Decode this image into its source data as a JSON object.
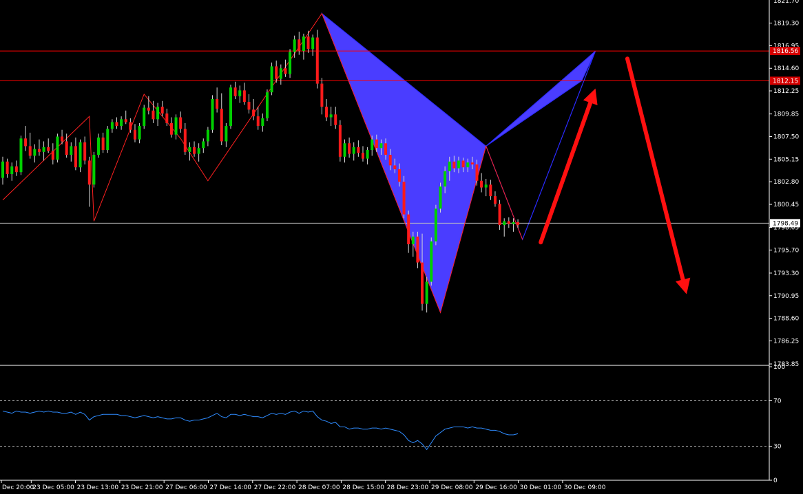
{
  "chart_data": {
    "type": "candlestick",
    "instrument_note": "",
    "colors": {
      "background": "#000000",
      "bull": "#00d000",
      "bear": "#ff1a1a",
      "zigzag": "#ff2020",
      "pattern_fill": "#4a3dff",
      "pattern_line": "#2a2aff",
      "arrow": "#ff1010",
      "level_line": "#ff0000",
      "rsi_line": "#2f8cff",
      "axis": "#ffffff",
      "current_price_line": "#c0c0c0"
    },
    "price_axis": {
      "ylim": [
        1783.85,
        1821.7
      ],
      "ticks": [
        "1819.30",
        "1816.95",
        "1814.60",
        "1812.25",
        "1809.85",
        "1807.50",
        "1805.15",
        "1802.80",
        "1800.45",
        "1798.05",
        "1795.70",
        "1793.30",
        "1790.95",
        "1788.60",
        "1786.25",
        "1783.85"
      ],
      "top_partial_tick": "1821.70"
    },
    "current_price": {
      "value": 1798.49,
      "label": "1798.49"
    },
    "levels": [
      {
        "value": 1816.4,
        "label": "1816.56"
      },
      {
        "value": 1813.3,
        "label": "1812.15"
      }
    ],
    "time_axis": {
      "labels": [
        "Dec 20:00",
        "23 Dec 05:00",
        "23 Dec 13:00",
        "23 Dec 21:00",
        "27 Dec 06:00",
        "27 Dec 14:00",
        "27 Dec 22:00",
        "28 Dec 07:00",
        "28 Dec 15:00",
        "28 Dec 23:00",
        "29 Dec 08:00",
        "29 Dec 16:00",
        "30 Dec 01:00",
        "30 Dec 09:00"
      ]
    },
    "candles": [
      {
        "o": 1803.2,
        "h": 1805.4,
        "l": 1802.5,
        "c": 1804.9
      },
      {
        "o": 1804.9,
        "h": 1805.2,
        "l": 1803.2,
        "c": 1803.6
      },
      {
        "o": 1803.6,
        "h": 1804.8,
        "l": 1802.9,
        "c": 1804.4
      },
      {
        "o": 1804.4,
        "h": 1805.0,
        "l": 1803.4,
        "c": 1803.8
      },
      {
        "o": 1803.8,
        "h": 1807.6,
        "l": 1803.5,
        "c": 1807.3
      },
      {
        "o": 1807.3,
        "h": 1808.6,
        "l": 1806.0,
        "c": 1806.5
      },
      {
        "o": 1806.5,
        "h": 1807.9,
        "l": 1805.2,
        "c": 1805.5
      },
      {
        "o": 1805.5,
        "h": 1806.7,
        "l": 1804.8,
        "c": 1806.2
      },
      {
        "o": 1806.2,
        "h": 1807.2,
        "l": 1805.5,
        "c": 1805.9
      },
      {
        "o": 1805.9,
        "h": 1807.0,
        "l": 1805.0,
        "c": 1806.4
      },
      {
        "o": 1806.4,
        "h": 1807.3,
        "l": 1805.8,
        "c": 1806.0
      },
      {
        "o": 1806.0,
        "h": 1806.8,
        "l": 1804.6,
        "c": 1805.1
      },
      {
        "o": 1805.1,
        "h": 1807.8,
        "l": 1804.8,
        "c": 1807.5
      },
      {
        "o": 1807.5,
        "h": 1808.2,
        "l": 1806.7,
        "c": 1807.0
      },
      {
        "o": 1807.0,
        "h": 1807.8,
        "l": 1805.3,
        "c": 1805.6
      },
      {
        "o": 1805.6,
        "h": 1806.9,
        "l": 1804.9,
        "c": 1806.5
      },
      {
        "o": 1806.5,
        "h": 1807.4,
        "l": 1804.0,
        "c": 1804.3
      },
      {
        "o": 1804.3,
        "h": 1807.2,
        "l": 1803.8,
        "c": 1806.9
      },
      {
        "o": 1806.9,
        "h": 1807.5,
        "l": 1804.6,
        "c": 1805.0
      },
      {
        "o": 1805.0,
        "h": 1805.4,
        "l": 1800.2,
        "c": 1802.5
      },
      {
        "o": 1802.5,
        "h": 1805.9,
        "l": 1802.2,
        "c": 1805.6
      },
      {
        "o": 1805.6,
        "h": 1807.8,
        "l": 1805.3,
        "c": 1807.4
      },
      {
        "o": 1807.4,
        "h": 1807.9,
        "l": 1805.8,
        "c": 1806.1
      },
      {
        "o": 1806.1,
        "h": 1808.6,
        "l": 1805.8,
        "c": 1808.3
      },
      {
        "o": 1808.3,
        "h": 1809.3,
        "l": 1807.9,
        "c": 1809.0
      },
      {
        "o": 1809.0,
        "h": 1809.5,
        "l": 1808.3,
        "c": 1808.6
      },
      {
        "o": 1808.6,
        "h": 1809.6,
        "l": 1808.2,
        "c": 1809.3
      },
      {
        "o": 1809.3,
        "h": 1810.2,
        "l": 1808.8,
        "c": 1809.0
      },
      {
        "o": 1809.0,
        "h": 1809.4,
        "l": 1807.9,
        "c": 1808.2
      },
      {
        "o": 1808.2,
        "h": 1808.8,
        "l": 1806.9,
        "c": 1807.2
      },
      {
        "o": 1807.2,
        "h": 1808.9,
        "l": 1806.8,
        "c": 1808.6
      },
      {
        "o": 1808.6,
        "h": 1810.8,
        "l": 1808.3,
        "c": 1810.5
      },
      {
        "o": 1810.5,
        "h": 1811.7,
        "l": 1809.8,
        "c": 1810.2
      },
      {
        "o": 1810.2,
        "h": 1811.2,
        "l": 1808.9,
        "c": 1809.3
      },
      {
        "o": 1809.3,
        "h": 1811.0,
        "l": 1808.6,
        "c": 1810.6
      },
      {
        "o": 1810.6,
        "h": 1811.2,
        "l": 1809.6,
        "c": 1809.9
      },
      {
        "o": 1809.9,
        "h": 1810.4,
        "l": 1808.6,
        "c": 1808.9
      },
      {
        "o": 1808.9,
        "h": 1809.5,
        "l": 1807.4,
        "c": 1807.7
      },
      {
        "o": 1807.7,
        "h": 1809.8,
        "l": 1807.2,
        "c": 1809.5
      },
      {
        "o": 1809.5,
        "h": 1810.1,
        "l": 1807.9,
        "c": 1808.3
      },
      {
        "o": 1808.3,
        "h": 1808.9,
        "l": 1805.6,
        "c": 1805.9
      },
      {
        "o": 1805.9,
        "h": 1806.9,
        "l": 1805.0,
        "c": 1806.4
      },
      {
        "o": 1806.4,
        "h": 1807.0,
        "l": 1805.4,
        "c": 1805.7
      },
      {
        "o": 1805.7,
        "h": 1806.8,
        "l": 1804.9,
        "c": 1806.3
      },
      {
        "o": 1806.3,
        "h": 1807.3,
        "l": 1805.8,
        "c": 1807.0
      },
      {
        "o": 1807.0,
        "h": 1808.5,
        "l": 1806.5,
        "c": 1808.2
      },
      {
        "o": 1808.2,
        "h": 1811.8,
        "l": 1807.9,
        "c": 1811.4
      },
      {
        "o": 1811.4,
        "h": 1812.6,
        "l": 1810.0,
        "c": 1810.4
      },
      {
        "o": 1810.4,
        "h": 1812.0,
        "l": 1806.6,
        "c": 1807.0
      },
      {
        "o": 1807.0,
        "h": 1808.9,
        "l": 1806.4,
        "c": 1808.6
      },
      {
        "o": 1808.6,
        "h": 1812.9,
        "l": 1808.3,
        "c": 1812.6
      },
      {
        "o": 1812.6,
        "h": 1813.2,
        "l": 1811.4,
        "c": 1811.7
      },
      {
        "o": 1811.7,
        "h": 1812.8,
        "l": 1811.0,
        "c": 1812.3
      },
      {
        "o": 1812.3,
        "h": 1813.1,
        "l": 1810.8,
        "c": 1811.1
      },
      {
        "o": 1811.1,
        "h": 1811.9,
        "l": 1809.9,
        "c": 1810.3
      },
      {
        "o": 1810.3,
        "h": 1811.4,
        "l": 1809.2,
        "c": 1809.6
      },
      {
        "o": 1809.6,
        "h": 1810.6,
        "l": 1808.2,
        "c": 1808.6
      },
      {
        "o": 1808.6,
        "h": 1809.9,
        "l": 1808.0,
        "c": 1809.4
      },
      {
        "o": 1809.4,
        "h": 1812.4,
        "l": 1809.1,
        "c": 1812.1
      },
      {
        "o": 1812.1,
        "h": 1815.2,
        "l": 1811.8,
        "c": 1814.8
      },
      {
        "o": 1814.8,
        "h": 1815.4,
        "l": 1813.1,
        "c": 1813.5
      },
      {
        "o": 1813.5,
        "h": 1815.0,
        "l": 1812.9,
        "c": 1814.6
      },
      {
        "o": 1814.6,
        "h": 1815.5,
        "l": 1813.7,
        "c": 1814.0
      },
      {
        "o": 1814.0,
        "h": 1816.6,
        "l": 1813.6,
        "c": 1816.3
      },
      {
        "o": 1816.3,
        "h": 1818.0,
        "l": 1815.7,
        "c": 1817.6
      },
      {
        "o": 1817.6,
        "h": 1818.4,
        "l": 1816.0,
        "c": 1816.4
      },
      {
        "o": 1816.4,
        "h": 1818.2,
        "l": 1815.5,
        "c": 1817.9
      },
      {
        "o": 1817.9,
        "h": 1818.5,
        "l": 1816.2,
        "c": 1816.6
      },
      {
        "o": 1816.6,
        "h": 1818.1,
        "l": 1815.9,
        "c": 1817.8
      },
      {
        "o": 1817.8,
        "h": 1818.6,
        "l": 1812.5,
        "c": 1813.0
      },
      {
        "o": 1813.0,
        "h": 1813.6,
        "l": 1809.8,
        "c": 1810.6
      },
      {
        "o": 1810.6,
        "h": 1811.4,
        "l": 1809.1,
        "c": 1809.5
      },
      {
        "o": 1809.5,
        "h": 1810.6,
        "l": 1808.6,
        "c": 1809.8
      },
      {
        "o": 1809.8,
        "h": 1810.6,
        "l": 1808.3,
        "c": 1808.7
      },
      {
        "o": 1808.7,
        "h": 1809.2,
        "l": 1804.9,
        "c": 1805.4
      },
      {
        "o": 1805.4,
        "h": 1807.2,
        "l": 1804.8,
        "c": 1806.8
      },
      {
        "o": 1806.8,
        "h": 1807.4,
        "l": 1805.3,
        "c": 1805.7
      },
      {
        "o": 1805.7,
        "h": 1806.9,
        "l": 1805.0,
        "c": 1806.4
      },
      {
        "o": 1806.4,
        "h": 1807.1,
        "l": 1805.4,
        "c": 1805.8
      },
      {
        "o": 1805.8,
        "h": 1806.5,
        "l": 1804.9,
        "c": 1805.2
      },
      {
        "o": 1805.2,
        "h": 1806.4,
        "l": 1804.6,
        "c": 1806.1
      },
      {
        "o": 1806.1,
        "h": 1807.6,
        "l": 1805.5,
        "c": 1807.2
      },
      {
        "o": 1807.2,
        "h": 1807.7,
        "l": 1805.9,
        "c": 1806.3
      },
      {
        "o": 1806.3,
        "h": 1807.2,
        "l": 1805.6,
        "c": 1806.8
      },
      {
        "o": 1806.8,
        "h": 1807.3,
        "l": 1805.1,
        "c": 1805.6
      },
      {
        "o": 1805.6,
        "h": 1806.2,
        "l": 1804.0,
        "c": 1804.5
      },
      {
        "o": 1804.5,
        "h": 1805.2,
        "l": 1803.7,
        "c": 1804.1
      },
      {
        "o": 1804.1,
        "h": 1804.7,
        "l": 1802.3,
        "c": 1802.8
      },
      {
        "o": 1802.8,
        "h": 1803.4,
        "l": 1799.0,
        "c": 1799.4
      },
      {
        "o": 1799.4,
        "h": 1799.8,
        "l": 1795.4,
        "c": 1796.3
      },
      {
        "o": 1796.3,
        "h": 1797.6,
        "l": 1795.0,
        "c": 1797.1
      },
      {
        "o": 1797.1,
        "h": 1797.6,
        "l": 1793.8,
        "c": 1794.4
      },
      {
        "o": 1794.4,
        "h": 1797.4,
        "l": 1789.4,
        "c": 1790.1
      },
      {
        "o": 1790.1,
        "h": 1792.9,
        "l": 1789.2,
        "c": 1792.4
      },
      {
        "o": 1792.4,
        "h": 1797.0,
        "l": 1792.0,
        "c": 1796.6
      },
      {
        "o": 1796.6,
        "h": 1800.4,
        "l": 1796.2,
        "c": 1800.0
      },
      {
        "o": 1800.0,
        "h": 1802.7,
        "l": 1799.6,
        "c": 1802.3
      },
      {
        "o": 1802.3,
        "h": 1804.4,
        "l": 1801.6,
        "c": 1803.9
      },
      {
        "o": 1803.9,
        "h": 1805.4,
        "l": 1802.9,
        "c": 1804.9
      },
      {
        "o": 1804.9,
        "h": 1805.5,
        "l": 1803.8,
        "c": 1804.2
      },
      {
        "o": 1804.2,
        "h": 1805.4,
        "l": 1803.7,
        "c": 1805.0
      },
      {
        "o": 1805.0,
        "h": 1805.3,
        "l": 1803.8,
        "c": 1804.3
      },
      {
        "o": 1804.3,
        "h": 1805.2,
        "l": 1803.8,
        "c": 1804.8
      },
      {
        "o": 1804.8,
        "h": 1805.4,
        "l": 1804.1,
        "c": 1804.6
      },
      {
        "o": 1804.6,
        "h": 1805.1,
        "l": 1802.4,
        "c": 1802.9
      },
      {
        "o": 1802.9,
        "h": 1803.7,
        "l": 1801.7,
        "c": 1802.2
      },
      {
        "o": 1802.2,
        "h": 1803.1,
        "l": 1801.3,
        "c": 1802.5
      },
      {
        "o": 1802.5,
        "h": 1803.0,
        "l": 1800.9,
        "c": 1801.3
      },
      {
        "o": 1801.3,
        "h": 1801.8,
        "l": 1800.2,
        "c": 1800.5
      },
      {
        "o": 1800.5,
        "h": 1800.9,
        "l": 1797.8,
        "c": 1798.3
      },
      {
        "o": 1798.3,
        "h": 1799.0,
        "l": 1797.1,
        "c": 1798.7
      },
      {
        "o": 1798.7,
        "h": 1799.1,
        "l": 1798.0,
        "c": 1798.4
      },
      {
        "o": 1798.4,
        "h": 1799.0,
        "l": 1797.6,
        "c": 1798.6
      },
      {
        "o": 1798.6,
        "h": 1798.9,
        "l": 1798.0,
        "c": 1798.3
      }
    ],
    "zigzag": [
      {
        "i": 0,
        "p": 1800.9
      },
      {
        "i": 19,
        "p": 1809.6
      },
      {
        "i": 20,
        "p": 1798.7
      },
      {
        "i": 31,
        "p": 1811.9
      },
      {
        "i": 39,
        "p": 1807.3
      },
      {
        "i": 45,
        "p": 1802.9
      },
      {
        "i": 70,
        "p": 1820.3
      },
      {
        "i": 96,
        "p": 1789.2
      },
      {
        "i": 106,
        "p": 1806.5
      },
      {
        "i": 114,
        "p": 1796.8
      }
    ],
    "pattern": {
      "X": {
        "i": 70,
        "p": 1820.3
      },
      "A": {
        "i": 96,
        "p": 1789.2
      },
      "B": {
        "i": 106,
        "p": 1806.5
      },
      "C": {
        "i": 114,
        "p": 1796.8
      },
      "D": {
        "i": 130,
        "p": 1816.4
      },
      "B2": {
        "i": 127,
        "p": 1813.3
      }
    },
    "arrows": [
      {
        "from": {
          "i": 118,
          "p": 1796.5
        },
        "to": {
          "i": 130,
          "p": 1812.5
        }
      },
      {
        "from": {
          "i": 137,
          "p": 1815.6
        },
        "to": {
          "i": 150,
          "p": 1791.1
        }
      }
    ],
    "rsi": {
      "ticks": [
        "100",
        "70",
        "30",
        "0"
      ],
      "levels": [
        70,
        30
      ],
      "values": [
        61,
        60,
        59,
        61,
        60,
        60,
        59,
        60,
        61,
        60,
        61,
        60,
        60,
        59,
        59,
        60,
        58,
        60,
        58,
        53,
        56,
        57,
        58,
        58,
        58,
        58,
        57,
        57,
        56,
        55,
        56,
        57,
        56,
        55,
        56,
        55,
        54,
        54,
        55,
        55,
        53,
        52,
        53,
        53,
        54,
        55,
        57,
        59,
        56,
        55,
        58,
        58,
        57,
        58,
        57,
        56,
        56,
        55,
        57,
        59,
        58,
        59,
        58,
        60,
        61,
        59,
        61,
        60,
        61,
        56,
        53,
        52,
        50,
        51,
        47,
        47,
        45,
        46,
        46,
        45,
        45,
        46,
        46,
        45,
        46,
        45,
        44,
        43,
        40,
        35,
        33,
        35,
        32,
        27,
        33,
        39,
        42,
        45,
        46,
        47,
        47,
        47,
        46,
        47,
        46,
        46,
        45,
        44,
        44,
        43,
        41,
        40,
        40,
        41
      ]
    }
  }
}
